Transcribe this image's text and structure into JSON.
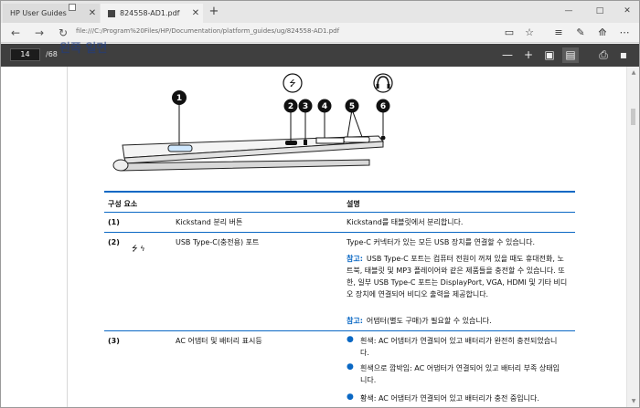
{
  "browser": {
    "tabs": [
      {
        "title": "HP User Guides",
        "icon": "page-icon"
      },
      {
        "title": "824558-AD1.pdf",
        "icon": "pdf-icon"
      }
    ],
    "new_tab_label": "+",
    "window_controls": [
      "—",
      "□",
      "✕"
    ],
    "address": "file:///C:/Program%20Files/HP/Documentation/platform_guides/ug/824558-AD1.pdf",
    "toolbar_icons": [
      "reading-view-icon",
      "favorite-star-icon",
      "hub-icon",
      "web-note-icon",
      "share-icon",
      "more-icon"
    ]
  },
  "pdf": {
    "page_current": "14",
    "page_total": "/68",
    "ghost_heading": "왼쪽 일면",
    "toolbar_icons": [
      "zoom-out-icon",
      "zoom-in-icon",
      "fit-page-icon",
      "page-view-icon",
      "print-icon",
      "save-icon"
    ]
  },
  "illustration": {
    "callouts": [
      "1",
      "2",
      "3",
      "4",
      "5",
      "6"
    ]
  },
  "table": {
    "headers": {
      "component": "구성 요소",
      "description": "설명"
    },
    "rows": [
      {
        "num": "(1)",
        "name": "Kickstand 분리 버튼",
        "desc": "Kickstand를 태블릿에서 분리합니다."
      },
      {
        "num": "(2)",
        "name": "USB Type-C(충전용) 포트",
        "desc": "Type-C 커넥터가 있는 모든 USB 장치를 연결할 수 있습니다.",
        "note1_label": "참고:",
        "note1": "USB Type-C 포트는 컴퓨터 전원이 꺼져 있을 때도 휴대전화, 노트북, 태블릿 및 MP3 플레이어와 같은 제품들을 충전할 수 있습니다. 또한, 일부 USB Type-C 포트는 DisplayPort, VGA, HDMI 및 기타 비디오 장치에 연결되어 비디오 출력을 제공합니다.",
        "note2_label": "참고:",
        "note2": "어댑터(별도 구매)가 필요할 수 있습니다."
      },
      {
        "num": "(3)",
        "name": "AC 어댑터 및 배터리 표시등",
        "bullets": [
          "흰색: AC 어댑터가 연결되어 있고 배터리가 완전히 충전되었습니다.",
          "흰색으로 깜박임: AC 어댑터가 연결되어 있고 배터리 부족 상태입니다.",
          "황색: AC 어댑터가 연결되어 있고 배터리가 충전 중입니다."
        ]
      }
    ]
  },
  "colors": {
    "accent": "#0a68c4",
    "pdf_toolbar": "#3f3f3f"
  }
}
